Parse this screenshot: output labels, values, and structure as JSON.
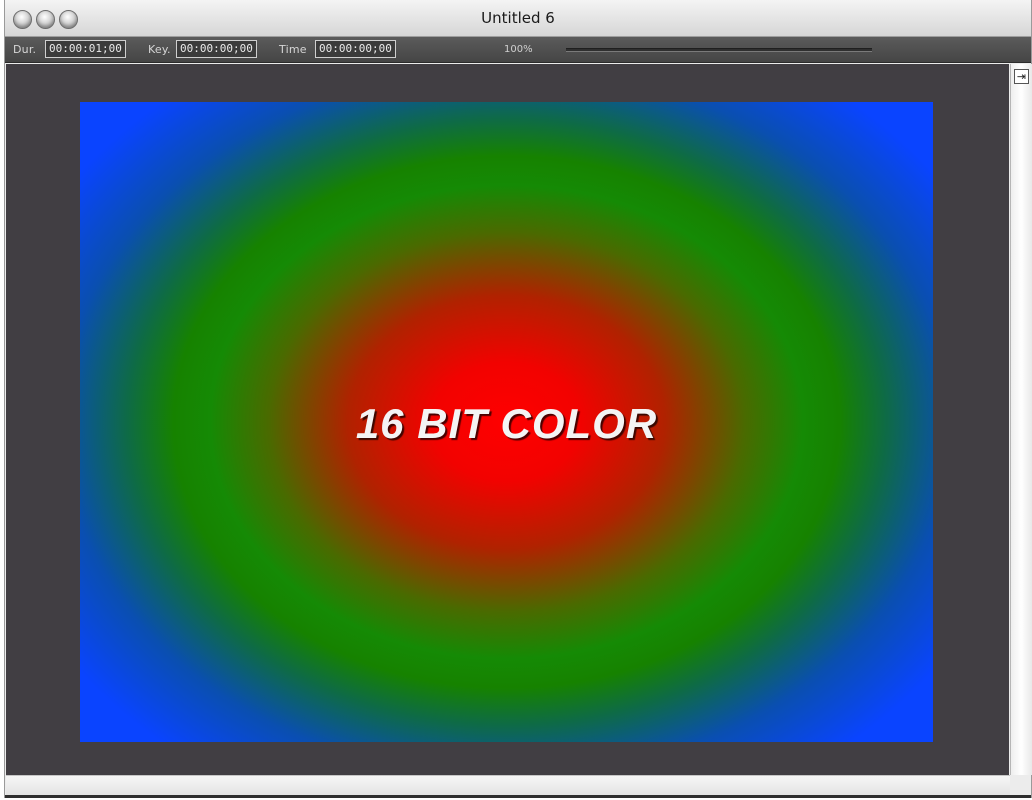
{
  "window": {
    "title": "Untitled 6"
  },
  "toolbar": {
    "dur_label": "Dur.",
    "dur_value": "00:00:01;00",
    "key_label": "Key.",
    "key_value": "00:00:00;00",
    "time_label": "Time",
    "time_value": "00:00:00;00",
    "zoom": "100%"
  },
  "canvas": {
    "text": "16 BIT COLOR",
    "gradient_colors": {
      "center": "#ff0000",
      "middle": "#158a05",
      "outer": "#0a44ff"
    }
  },
  "viewer": {
    "background": "#413e43"
  },
  "icons": {
    "panel_toggle": "panel-toggle-icon"
  }
}
